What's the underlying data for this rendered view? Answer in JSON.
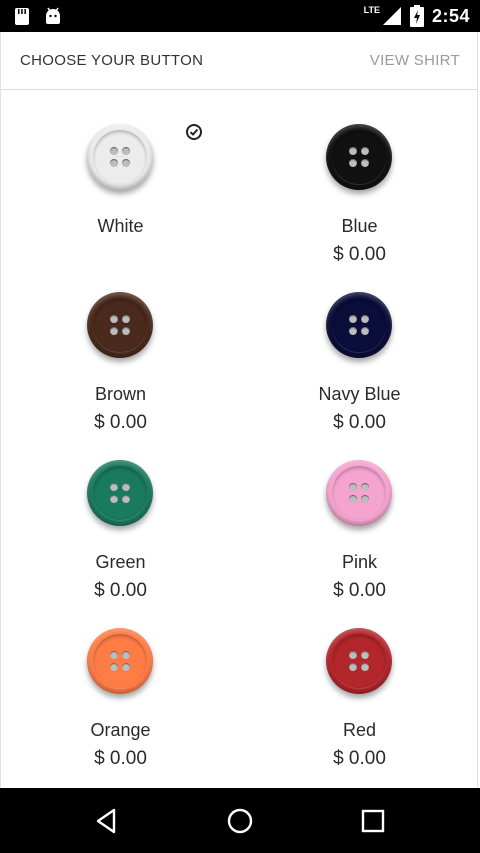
{
  "status_bar": {
    "time": "2:54",
    "network": "LTE"
  },
  "header": {
    "title": "CHOOSE YOUR BUTTON",
    "action": "VIEW SHIRT"
  },
  "buttons": [
    {
      "name": "White",
      "price": "",
      "color": "#ececec",
      "selected": true
    },
    {
      "name": "Blue",
      "price": "$ 0.00",
      "color": "#111111",
      "selected": false
    },
    {
      "name": "Brown",
      "price": "$ 0.00",
      "color": "#4a2a1c",
      "selected": false
    },
    {
      "name": "Navy Blue",
      "price": "$ 0.00",
      "color": "#0b0d3a",
      "selected": false
    },
    {
      "name": "Green",
      "price": "$ 0.00",
      "color": "#1a7a5e",
      "selected": false
    },
    {
      "name": "Pink",
      "price": "$ 0.00",
      "color": "#f5a3cf",
      "selected": false
    },
    {
      "name": "Orange",
      "price": "$ 0.00",
      "color": "#ff7c45",
      "selected": false
    },
    {
      "name": "Red",
      "price": "$ 0.00",
      "color": "#b3262b",
      "selected": false
    }
  ],
  "icons": {
    "status_left": [
      "android-notification-icon",
      "android-robot-icon"
    ],
    "status_right": [
      "signal-icon",
      "battery-charging-icon"
    ],
    "nav": [
      "back-icon",
      "home-icon",
      "recents-icon"
    ]
  }
}
